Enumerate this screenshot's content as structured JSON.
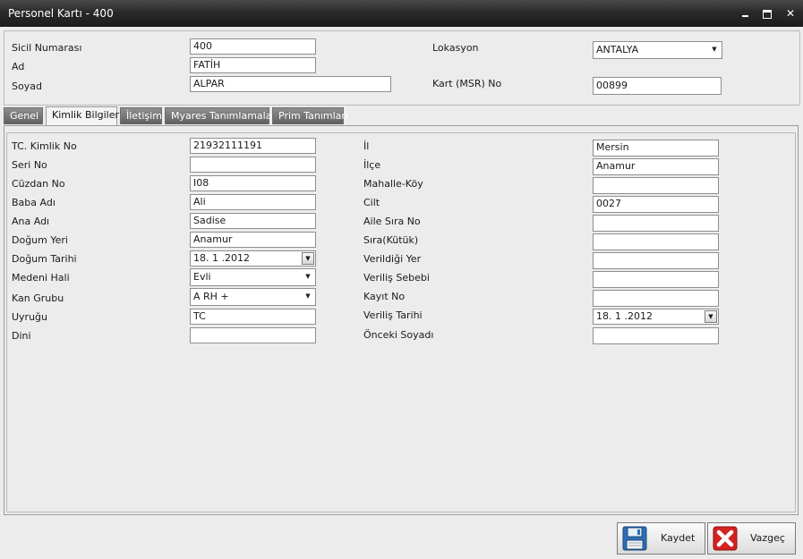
{
  "window": {
    "title": "Personel Kartı - 400"
  },
  "header": {
    "sicil_label": "Sicil Numarası",
    "sicil_value": "400",
    "ad_label": "Ad",
    "ad_value": "FATİH",
    "soyad_label": "Soyad",
    "soyad_value": "ALPAR",
    "lokasyon_label": "Lokasyon",
    "lokasyon_value": "ANTALYA",
    "kart_label": "Kart (MSR) No",
    "kart_value": "00899"
  },
  "tabs": [
    {
      "label": "Genel"
    },
    {
      "label": "Kimlik Bilgileri"
    },
    {
      "label": "İletişim"
    },
    {
      "label": "Myares Tanımlamaları"
    },
    {
      "label": "Prim Tanımları"
    }
  ],
  "left_fields": [
    {
      "label": "TC. Kimlik No",
      "value": "21932111191"
    },
    {
      "label": "Seri No",
      "value": ""
    },
    {
      "label": "Cüzdan No",
      "value": "I08"
    },
    {
      "label": "Baba Adı",
      "value": "Ali"
    },
    {
      "label": "Ana Adı",
      "value": "Sadise"
    },
    {
      "label": "Doğum Yeri",
      "value": "Anamur"
    },
    {
      "label": "Doğum Tarihi",
      "value": "18. 1 .2012"
    },
    {
      "label": "Medeni Hali",
      "value": "Evli"
    },
    {
      "label": "Kan Grubu",
      "value": "A RH +"
    },
    {
      "label": "Uyruğu",
      "value": "TC"
    },
    {
      "label": "Dini",
      "value": ""
    }
  ],
  "right_fields": [
    {
      "label": "İl",
      "value": "Mersin"
    },
    {
      "label": "İlçe",
      "value": "Anamur"
    },
    {
      "label": "Mahalle-Köy",
      "value": ""
    },
    {
      "label": "Cilt",
      "value": "0027"
    },
    {
      "label": "Aile Sıra No",
      "value": ""
    },
    {
      "label": "Sıra(Kütük)",
      "value": ""
    },
    {
      "label": "Verildiği Yer",
      "value": ""
    },
    {
      "label": "Veriliş Sebebi",
      "value": ""
    },
    {
      "label": "Kayıt No",
      "value": ""
    },
    {
      "label": "Veriliş Tarihi",
      "value": "18. 1 .2012"
    },
    {
      "label": "Önceki Soyadı",
      "value": ""
    }
  ],
  "footer": {
    "save_label": "Kaydet",
    "cancel_label": "Vazgeç"
  },
  "icons": {
    "save": "floppy-disk-icon",
    "cancel": "red-x-icon",
    "minimize": "minimize-icon",
    "maximize": "maximize-icon",
    "close": "close-icon"
  },
  "colors": {
    "titlebar": "#2a2a2a",
    "save_icon": "#2d6fb5",
    "cancel_icon": "#d32222"
  }
}
